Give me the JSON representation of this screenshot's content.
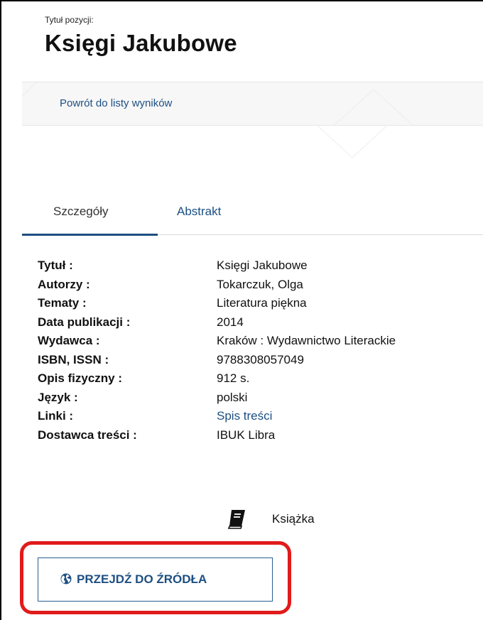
{
  "header": {
    "pre_title": "Tytuł pozycji:",
    "title": "Księgi Jakubowe"
  },
  "navigation": {
    "back_link": "Powrót do listy wyników"
  },
  "tabs": [
    {
      "label": "Szczegóły",
      "active": true
    },
    {
      "label": "Abstrakt",
      "active": false
    }
  ],
  "details": [
    {
      "label": "Tytuł :",
      "value": "Księgi Jakubowe"
    },
    {
      "label": "Autorzy :",
      "value": "Tokarczuk, Olga"
    },
    {
      "label": "Tematy :",
      "value": "Literatura piękna"
    },
    {
      "label": "Data publikacji :",
      "value": "2014"
    },
    {
      "label": "Wydawca :",
      "value": "Kraków : Wydawnictwo Literackie"
    },
    {
      "label": "ISBN, ISSN :",
      "value": "9788308057049"
    },
    {
      "label": "Opis fizyczny :",
      "value": "912 s."
    },
    {
      "label": "Język :",
      "value": "polski"
    },
    {
      "label": "Linki :",
      "value": "Spis treści"
    },
    {
      "label": "Dostawca treści :",
      "value": "IBUK Libra"
    }
  ],
  "item_type": {
    "icon": "book-icon",
    "label": "Książka"
  },
  "source_button": {
    "icon": "globe-icon",
    "label": "PRZEJDŹ DO ŹRÓDŁA"
  },
  "colors": {
    "link": "#1d4f82",
    "highlight": "#e11b1b",
    "text": "#111111"
  }
}
